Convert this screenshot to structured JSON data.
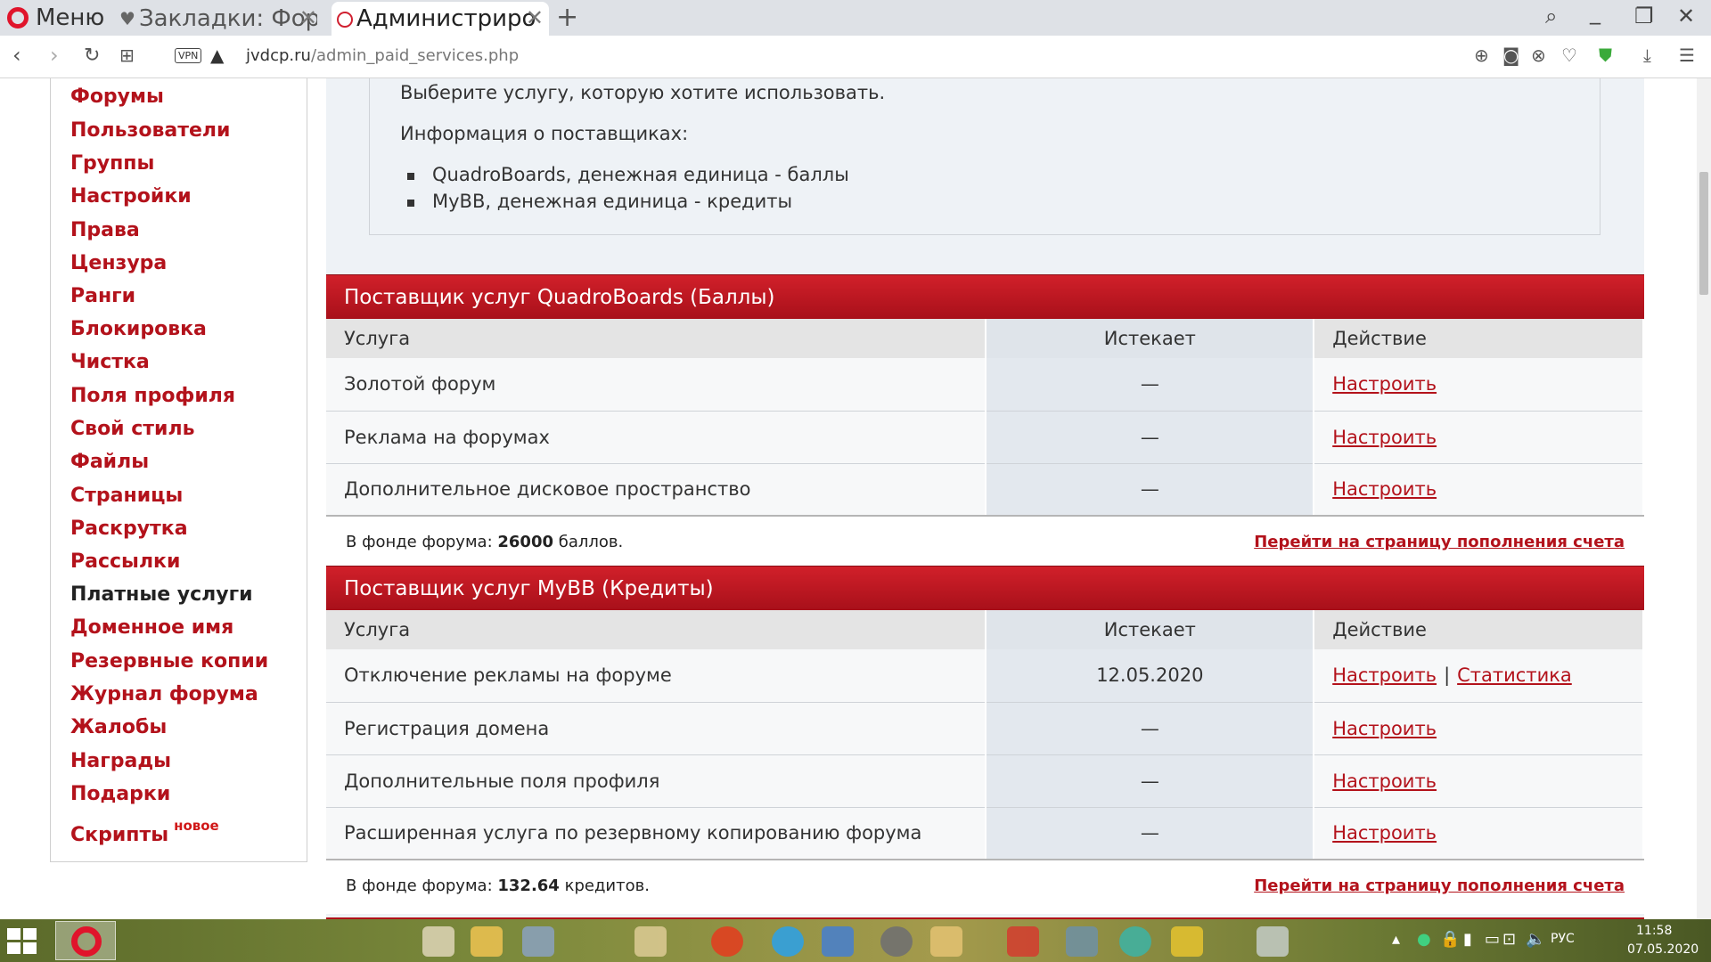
{
  "browser": {
    "menu_label": "Меню",
    "tabs": [
      {
        "title": "Закладки: Фору"
      },
      {
        "title": "Администрирова"
      }
    ],
    "url_domain": "jvdcp.ru",
    "url_path": "/admin_paid_services.php",
    "vpn_label": "VPN"
  },
  "sidebar": {
    "items": [
      {
        "label": "Форумы"
      },
      {
        "label": "Пользователи"
      },
      {
        "label": "Группы"
      },
      {
        "label": "Настройки"
      },
      {
        "label": "Права"
      },
      {
        "label": "Цензура"
      },
      {
        "label": "Ранги"
      },
      {
        "label": "Блокировка"
      },
      {
        "label": "Чистка"
      },
      {
        "label": "Поля профиля"
      },
      {
        "label": "Свой стиль"
      },
      {
        "label": "Файлы"
      },
      {
        "label": "Страницы"
      },
      {
        "label": "Раскрутка"
      },
      {
        "label": "Рассылки"
      },
      {
        "label": "Платные услуги"
      },
      {
        "label": "Доменное имя"
      },
      {
        "label": "Резервные копии"
      },
      {
        "label": "Журнал форума"
      },
      {
        "label": "Жалобы"
      },
      {
        "label": "Награды"
      },
      {
        "label": "Подарки"
      },
      {
        "label": "Скрипты",
        "badge": "новое"
      }
    ]
  },
  "info": {
    "choose_text": "Выберите услугу, которую хотите использовать.",
    "providers_heading": "Информация о поставщиках:",
    "providers": [
      "QuadroBoards, денежная единица - баллы",
      "MyBB, денежная единица - кредиты"
    ]
  },
  "sections": [
    {
      "title": "Поставщик услуг QuadroBoards (Баллы)",
      "columns": {
        "service": "Услуга",
        "expires": "Истекает",
        "action": "Действие"
      },
      "rows": [
        {
          "service": "Золотой форум",
          "expires": "—",
          "action": "Настроить"
        },
        {
          "service": "Реклама на форумах",
          "expires": "—",
          "action": "Настроить"
        },
        {
          "service": "Дополнительное дисковое пространство",
          "expires": "—",
          "action": "Настроить"
        }
      ],
      "fund_prefix": "В фонде форума:",
      "fund_amount": "26000",
      "fund_unit": "баллов.",
      "fund_link": "Перейти на страницу пополнения счета"
    },
    {
      "title": "Поставщик услуг MyBB (Кредиты)",
      "columns": {
        "service": "Услуга",
        "expires": "Истекает",
        "action": "Действие"
      },
      "rows": [
        {
          "service": "Отключение рекламы на форуме",
          "expires": "12.05.2020",
          "action": "Настроить",
          "action2": "Статистика",
          "separator": "|"
        },
        {
          "service": "Регистрация домена",
          "expires": "—",
          "action": "Настроить"
        },
        {
          "service": "Дополнительные поля профиля",
          "expires": "—",
          "action": "Настроить"
        },
        {
          "service": "Расширенная услуга по резервному копированию форума",
          "expires": "—",
          "action": "Настроить"
        }
      ],
      "fund_prefix": "В фонде форума:",
      "fund_amount": "132.64",
      "fund_unit": "кредитов.",
      "fund_link": "Перейти на страницу пополнения счета"
    }
  ],
  "taskbar": {
    "language": "РУС",
    "time": "11:58",
    "date": "07.05.2020"
  },
  "colors": {
    "accent_red": "#b3121b",
    "header_red": "#c0141f",
    "content_bg": "#eef2f6"
  }
}
